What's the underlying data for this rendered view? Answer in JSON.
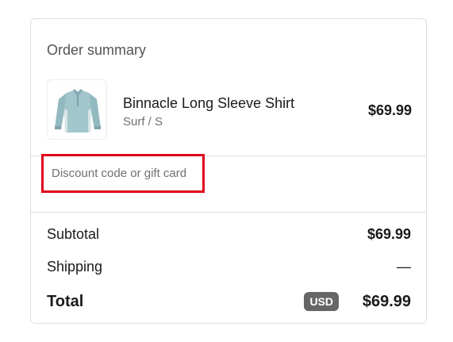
{
  "summary": {
    "title": "Order summary"
  },
  "product": {
    "name": "Binnacle Long Sleeve Shirt",
    "variant": "Surf / S",
    "price": "$69.99",
    "image_icon": "long-sleeve-shirt-icon",
    "image_color": "#9fc3c9"
  },
  "discount": {
    "placeholder": "Discount code or gift card",
    "value": "",
    "highlight_color": "#e0001b"
  },
  "totals": {
    "subtotal_label": "Subtotal",
    "subtotal_value": "$69.99",
    "shipping_label": "Shipping",
    "shipping_value": "—",
    "total_label": "Total",
    "currency": "USD",
    "total_value": "$69.99"
  }
}
